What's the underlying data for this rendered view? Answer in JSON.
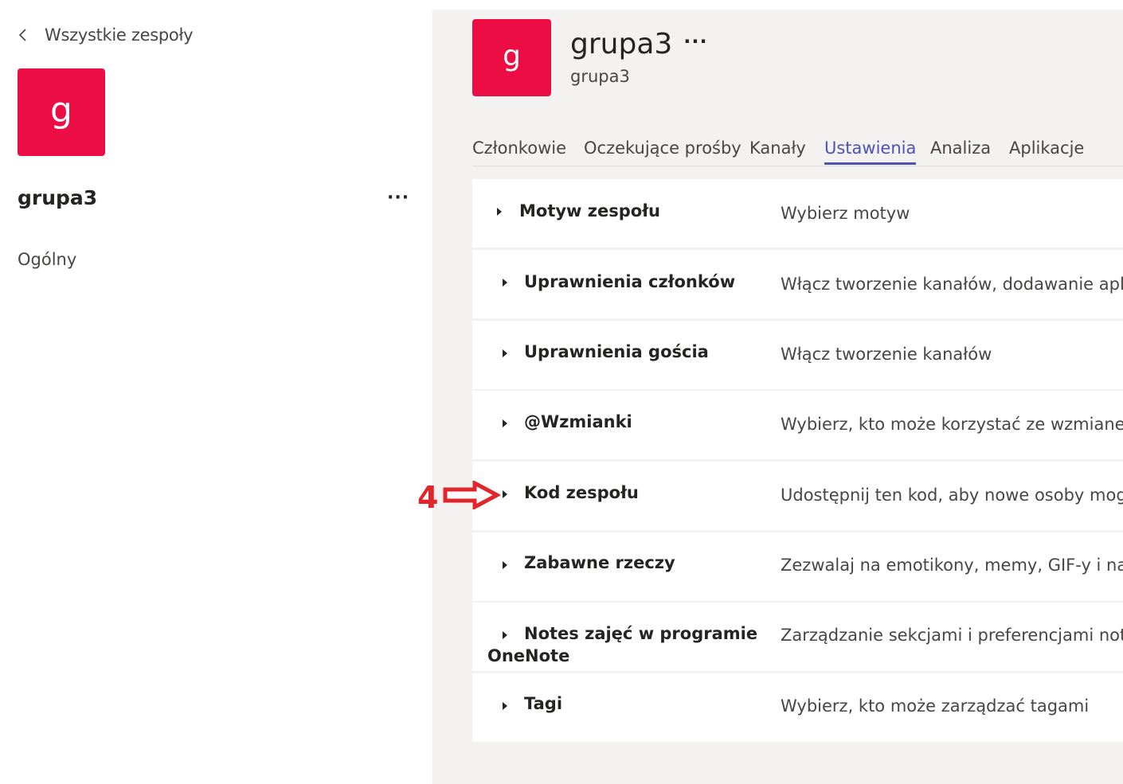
{
  "sidebar": {
    "back_label": "Wszystkie zespoły",
    "avatar_letter": "g",
    "team_name": "grupa3",
    "more_label": "···",
    "channels": [
      "Ogólny"
    ]
  },
  "header": {
    "avatar_letter": "g",
    "title": "grupa3",
    "more_label": "···",
    "subtitle": "grupa3"
  },
  "tabs": [
    {
      "label": "Członkowie"
    },
    {
      "label": "Oczekujące prośby"
    },
    {
      "label": "Kanały"
    },
    {
      "label": "Ustawienia",
      "active": true
    },
    {
      "label": "Analiza"
    },
    {
      "label": "Aplikacje"
    }
  ],
  "settings": [
    {
      "title": "Motyw zespołu",
      "description": "Wybierz motyw"
    },
    {
      "title": "Uprawnienia członków",
      "description": "Włącz tworzenie kanałów, dodawanie aplikacji"
    },
    {
      "title": "Uprawnienia gościa",
      "description": "Włącz tworzenie kanałów"
    },
    {
      "title": "@Wzmianki",
      "description": "Wybierz, kto może korzystać ze wzmianek @zespół"
    },
    {
      "title": "Kod zespołu",
      "description": "Udostępnij ten kod, aby nowe osoby mogły bezpośrednio dołączyć"
    },
    {
      "title": "Zabawne rzeczy",
      "description": "Zezwalaj na emotikony, memy, GIF-y i naklejki"
    },
    {
      "title_line1": "Notes zajęć w programie",
      "title_line2": "OneNote",
      "description": "Zarządzanie sekcjami i preferencjami notesu"
    },
    {
      "title": "Tagi",
      "description": "Wybierz, kto może zarządzać tagami"
    }
  ],
  "annotation": {
    "number": "4",
    "color": "#e0262a"
  },
  "colors": {
    "avatar": "#eb0d43",
    "accent": "#4f52b2",
    "panel_bg": "#f3f2f1"
  }
}
